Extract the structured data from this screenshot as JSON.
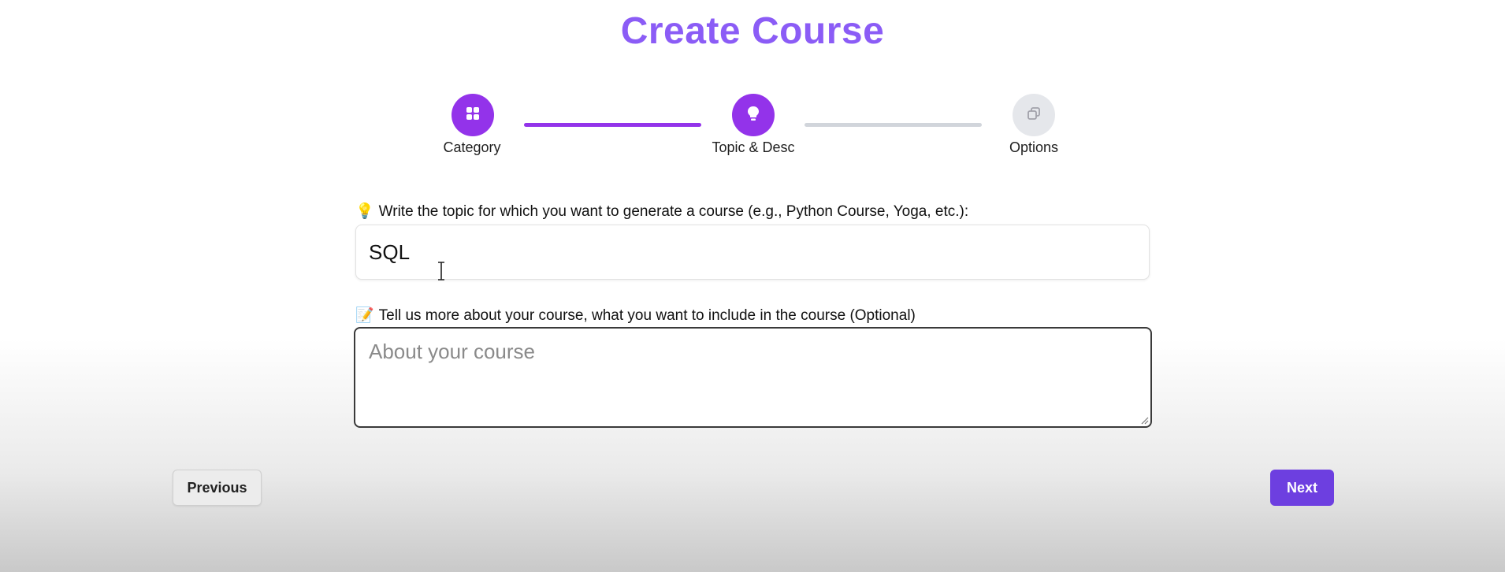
{
  "header": {
    "title": "Create Course"
  },
  "stepper": {
    "steps": [
      {
        "label": "Category",
        "icon": "grid-icon",
        "state": "complete"
      },
      {
        "label": "Topic & Desc",
        "icon": "lightbulb-icon",
        "state": "active"
      },
      {
        "label": "Options",
        "icon": "copy-icon",
        "state": "upcoming"
      }
    ]
  },
  "form": {
    "topic": {
      "emoji": "💡",
      "label": "Write the topic for which you want to generate a course (e.g., Python Course, Yoga, etc.):",
      "value": "SQL"
    },
    "description": {
      "emoji": "📝",
      "label": "Tell us more about your course, what you want to include in the course (Optional)",
      "placeholder": "About your course",
      "value": ""
    }
  },
  "navigation": {
    "previous_label": "Previous",
    "next_label": "Next"
  },
  "colors": {
    "accent": "#9333ea",
    "title": "#8b5cf6",
    "next_button": "#6d3fe0",
    "inactive_step": "#e5e7eb"
  }
}
